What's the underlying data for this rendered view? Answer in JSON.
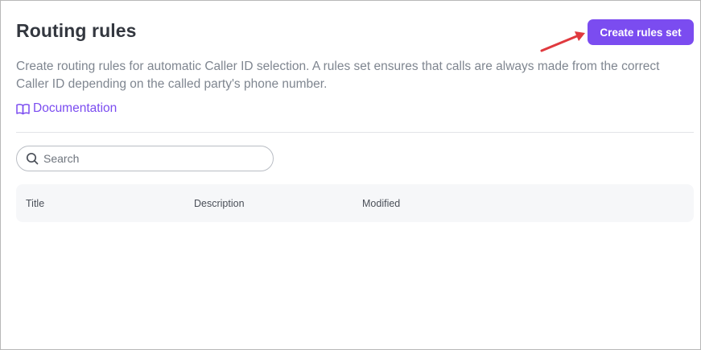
{
  "header": {
    "title": "Routing rules",
    "create_button_label": "Create rules set"
  },
  "description": "Create routing rules for automatic Caller ID selection. A rules set ensures that calls are always made from the correct Caller ID depending on the called party's phone number.",
  "documentation_link": {
    "label": "Documentation",
    "icon": "book-icon"
  },
  "search": {
    "placeholder": "Search",
    "value": "",
    "icon": "search-icon"
  },
  "table": {
    "columns": [
      "Title",
      "Description",
      "Modified"
    ],
    "rows": []
  },
  "colors": {
    "accent": "#7b4cf0",
    "annotation_arrow": "#e0393e"
  }
}
